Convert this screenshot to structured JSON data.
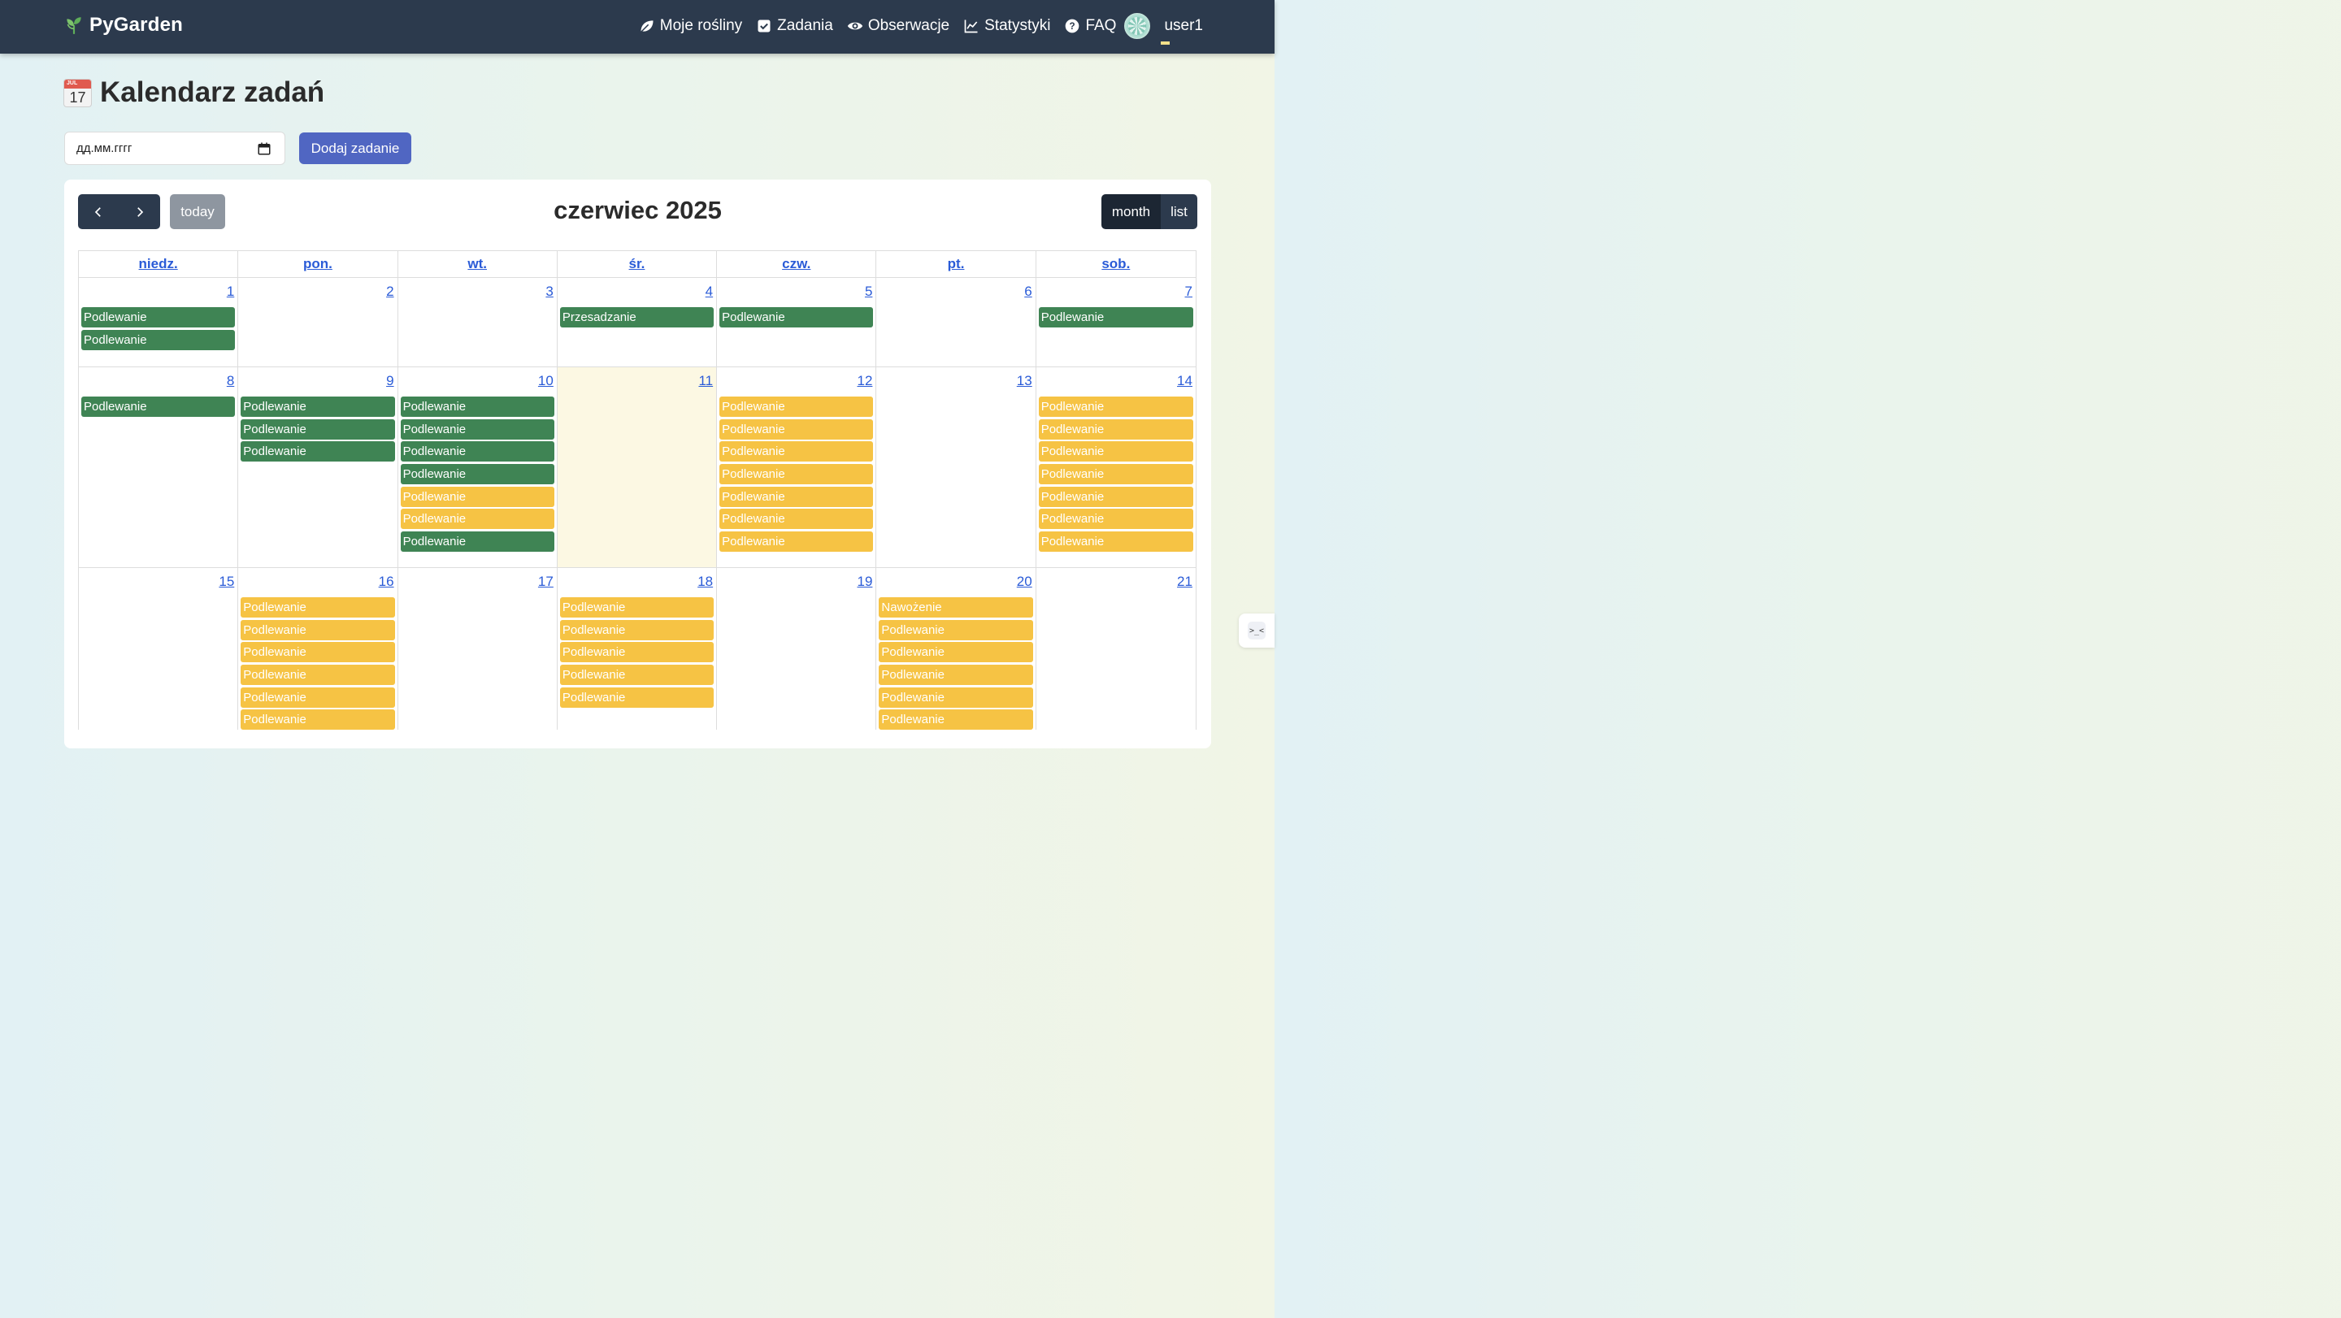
{
  "brand": {
    "name": "PyGarden",
    "icon": "seedling-icon"
  },
  "nav": {
    "items": [
      {
        "label": "Moje rośliny",
        "icon": "leaf-icon"
      },
      {
        "label": "Zadania",
        "icon": "check-square-icon"
      },
      {
        "label": "Obserwacje",
        "icon": "eye-icon"
      },
      {
        "label": "Statystyki",
        "icon": "chart-line-icon"
      },
      {
        "label": "FAQ",
        "icon": "question-circle-icon"
      }
    ],
    "user": "user1"
  },
  "page": {
    "title": "Kalendarz zadań",
    "title_icon": "calendar-icon",
    "calendar_icon_month": "JUL",
    "calendar_icon_day": "17"
  },
  "form": {
    "date_placeholder": "дд.мм.гггг",
    "add_label": "Dodaj zadanie"
  },
  "calendar": {
    "title": "czerwiec 2025",
    "today_label": "today",
    "views": {
      "month": "month",
      "list": "list"
    },
    "active_view": "month",
    "days_of_week": [
      "niedz.",
      "pon.",
      "wt.",
      "śr.",
      "czw.",
      "pt.",
      "sob."
    ],
    "weeks": [
      {
        "days": [
          {
            "num": "1",
            "events": [
              {
                "label": "Podlewanie",
                "color": "green"
              },
              {
                "label": "Podlewanie",
                "color": "green"
              }
            ]
          },
          {
            "num": "2",
            "events": []
          },
          {
            "num": "3",
            "events": []
          },
          {
            "num": "4",
            "events": [
              {
                "label": "Przesadzanie",
                "color": "green"
              }
            ]
          },
          {
            "num": "5",
            "events": [
              {
                "label": "Podlewanie",
                "color": "green"
              }
            ]
          },
          {
            "num": "6",
            "events": []
          },
          {
            "num": "7",
            "events": [
              {
                "label": "Podlewanie",
                "color": "green"
              }
            ]
          }
        ]
      },
      {
        "days": [
          {
            "num": "8",
            "events": [
              {
                "label": "Podlewanie",
                "color": "green"
              }
            ]
          },
          {
            "num": "9",
            "events": [
              {
                "label": "Podlewanie",
                "color": "green"
              },
              {
                "label": "Podlewanie",
                "color": "green"
              },
              {
                "label": "Podlewanie",
                "color": "green"
              }
            ]
          },
          {
            "num": "10",
            "events": [
              {
                "label": "Podlewanie",
                "color": "green"
              },
              {
                "label": "Podlewanie",
                "color": "green"
              },
              {
                "label": "Podlewanie",
                "color": "green"
              },
              {
                "label": "Podlewanie",
                "color": "green"
              },
              {
                "label": "Podlewanie",
                "color": "yellow"
              },
              {
                "label": "Podlewanie",
                "color": "yellow"
              },
              {
                "label": "Podlewanie",
                "color": "green"
              }
            ]
          },
          {
            "num": "11",
            "today": true,
            "events": []
          },
          {
            "num": "12",
            "events": [
              {
                "label": "Podlewanie",
                "color": "yellow"
              },
              {
                "label": "Podlewanie",
                "color": "yellow"
              },
              {
                "label": "Podlewanie",
                "color": "yellow"
              },
              {
                "label": "Podlewanie",
                "color": "yellow"
              },
              {
                "label": "Podlewanie",
                "color": "yellow"
              },
              {
                "label": "Podlewanie",
                "color": "yellow"
              },
              {
                "label": "Podlewanie",
                "color": "yellow"
              }
            ]
          },
          {
            "num": "13",
            "events": []
          },
          {
            "num": "14",
            "events": [
              {
                "label": "Podlewanie",
                "color": "yellow"
              },
              {
                "label": "Podlewanie",
                "color": "yellow"
              },
              {
                "label": "Podlewanie",
                "color": "yellow"
              },
              {
                "label": "Podlewanie",
                "color": "yellow"
              },
              {
                "label": "Podlewanie",
                "color": "yellow"
              },
              {
                "label": "Podlewanie",
                "color": "yellow"
              },
              {
                "label": "Podlewanie",
                "color": "yellow"
              }
            ]
          }
        ]
      },
      {
        "days": [
          {
            "num": "15",
            "events": []
          },
          {
            "num": "16",
            "events": [
              {
                "label": "Podlewanie",
                "color": "yellow"
              },
              {
                "label": "Podlewanie",
                "color": "yellow"
              },
              {
                "label": "Podlewanie",
                "color": "yellow"
              },
              {
                "label": "Podlewanie",
                "color": "yellow"
              },
              {
                "label": "Podlewanie",
                "color": "yellow"
              },
              {
                "label": "Podlewanie",
                "color": "yellow"
              }
            ]
          },
          {
            "num": "17",
            "events": []
          },
          {
            "num": "18",
            "events": [
              {
                "label": "Podlewanie",
                "color": "yellow"
              },
              {
                "label": "Podlewanie",
                "color": "yellow"
              },
              {
                "label": "Podlewanie",
                "color": "yellow"
              },
              {
                "label": "Podlewanie",
                "color": "yellow"
              },
              {
                "label": "Podlewanie",
                "color": "yellow"
              }
            ]
          },
          {
            "num": "19",
            "events": []
          },
          {
            "num": "20",
            "events": [
              {
                "label": "Nawożenie",
                "color": "yellow"
              },
              {
                "label": "Podlewanie",
                "color": "yellow"
              },
              {
                "label": "Podlewanie",
                "color": "yellow"
              },
              {
                "label": "Podlewanie",
                "color": "yellow"
              },
              {
                "label": "Podlewanie",
                "color": "yellow"
              },
              {
                "label": "Podlewanie",
                "color": "yellow"
              }
            ]
          },
          {
            "num": "21",
            "events": []
          }
        ]
      }
    ]
  },
  "side_widget": {
    "icon": "assistant-face-icon",
    "glyph": ">_<"
  },
  "colors": {
    "navbar": "#2c3a4d",
    "primary": "#5066c2",
    "event_green": "#3f8454",
    "event_yellow": "#f6c344",
    "today_bg": "#fcf8e3",
    "link": "#2a5bd7"
  }
}
